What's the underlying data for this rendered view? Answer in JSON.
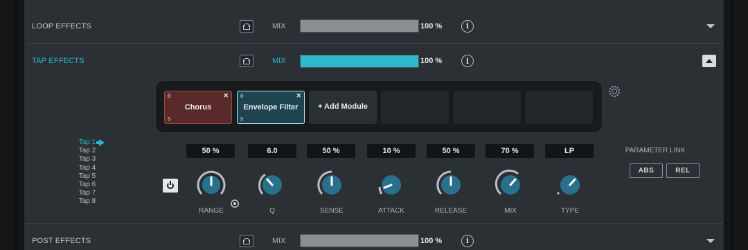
{
  "loop_effects": {
    "title": "LOOP EFFECTS",
    "mix_label": "MIX",
    "mix_value": "100 %",
    "mix_percent": 100
  },
  "tap_effects": {
    "title": "TAP EFFECTS",
    "mix_label": "MIX",
    "mix_value": "100 %",
    "mix_percent": 100,
    "modules": [
      {
        "name": "Chorus",
        "state": "loaded"
      },
      {
        "name": "Envelope Filter",
        "state": "selected"
      },
      {
        "name": "+ Add Module",
        "state": "add"
      },
      {
        "name": "",
        "state": "empty"
      },
      {
        "name": "",
        "state": "empty"
      },
      {
        "name": "",
        "state": "empty"
      }
    ],
    "taps": [
      "Tap 1",
      "Tap 2",
      "Tap 3",
      "Tap 4",
      "Tap 5",
      "Tap 6",
      "Tap 7",
      "Tap 8"
    ],
    "active_tap": "Tap 1",
    "knobs": [
      {
        "label": "RANGE",
        "value": "50 %"
      },
      {
        "label": "Q",
        "value": "6.0"
      },
      {
        "label": "SENSE",
        "value": "50 %"
      },
      {
        "label": "ATTACK",
        "value": "10 %"
      },
      {
        "label": "RELEASE",
        "value": "50 %"
      },
      {
        "label": "MIX",
        "value": "70 %"
      },
      {
        "label": "TYPE",
        "value": "LP"
      }
    ],
    "parameter_link": {
      "label": "PARAMETER LINK",
      "abs": "ABS",
      "rel": "REL"
    }
  },
  "post_effects": {
    "title": "POST EFFECTS",
    "mix_label": "MIX",
    "mix_value": "100 %",
    "mix_percent": 100
  },
  "glyphs": {
    "lock": "ö",
    "s": "s",
    "x": "✕",
    "info": "i"
  },
  "colors": {
    "accent": "#2fb4d1",
    "mix_fill": "#2fb7cc",
    "module_red": "#5a2a2a",
    "module_blue": "#1e4450"
  }
}
